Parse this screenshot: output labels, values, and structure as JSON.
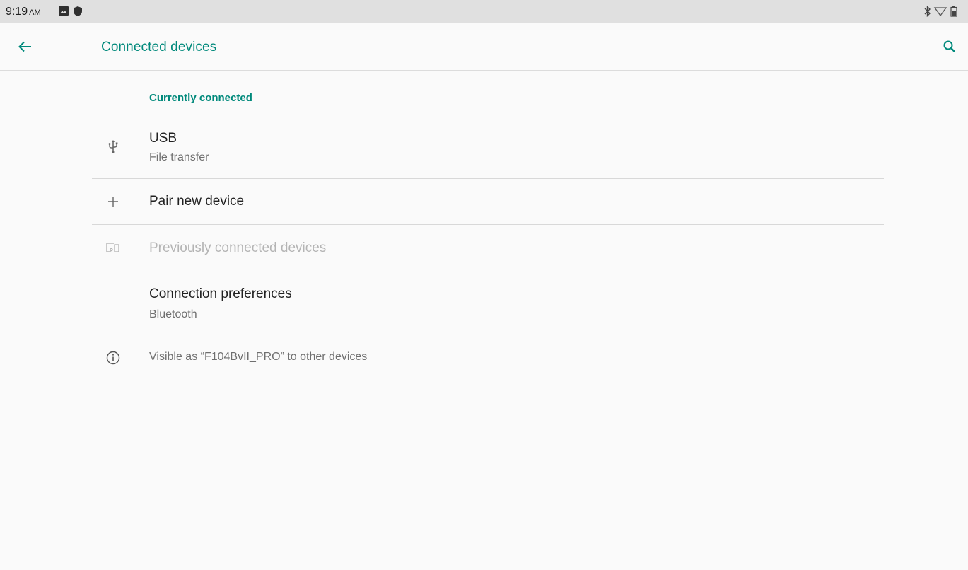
{
  "status_bar": {
    "time": "9:19",
    "ampm": "AM",
    "left_icons": [
      "image-icon",
      "shield-icon"
    ],
    "right_icons": [
      "bluetooth-icon",
      "wifi-icon",
      "battery-icon"
    ]
  },
  "app_bar": {
    "title": "Connected devices",
    "back_icon": "arrow-back-icon",
    "search_icon": "search-icon"
  },
  "colors": {
    "accent": "#00897b",
    "background": "#fafafa",
    "status_bar": "#e0e0e0",
    "text_primary": "#212121",
    "text_secondary": "#6f6f6f",
    "text_disabled": "#b4b4b4"
  },
  "sections": {
    "currently_connected": {
      "header": "Currently connected",
      "items": [
        {
          "icon": "usb-icon",
          "title": "USB",
          "summary": "File transfer"
        }
      ]
    }
  },
  "pair_new_device": {
    "icon": "plus-icon",
    "title": "Pair new device"
  },
  "previously_connected": {
    "icon": "devices-icon",
    "title": "Previously connected devices",
    "disabled": true
  },
  "connection_preferences": {
    "title": "Connection preferences",
    "summary": "Bluetooth"
  },
  "footer": {
    "icon": "info-icon",
    "text": "Visible as “F104BvII_PRO” to other devices"
  }
}
